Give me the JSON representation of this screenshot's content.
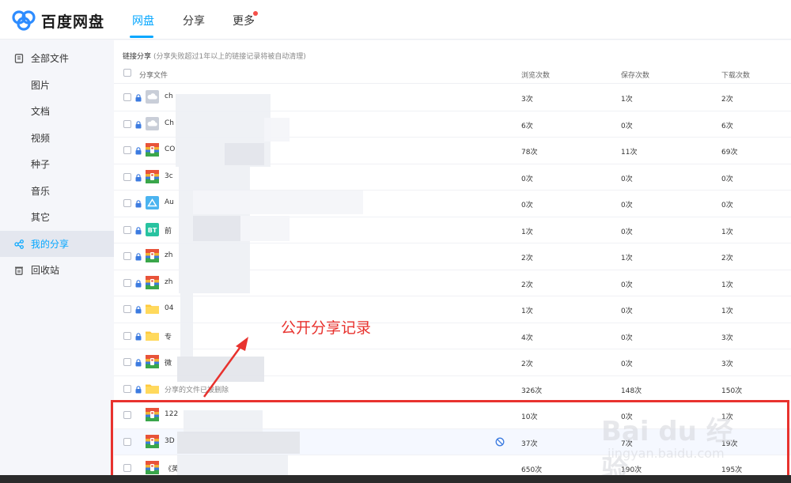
{
  "app": {
    "title": "百度网盘"
  },
  "nav": {
    "tabs": [
      "网盘",
      "分享",
      "更多"
    ],
    "active": 0
  },
  "sidebar": {
    "items": [
      "全部文件",
      "图片",
      "文档",
      "视频",
      "种子",
      "音乐",
      "其它",
      "我的分享",
      "回收站"
    ],
    "active": 7
  },
  "main": {
    "title": "链接分享",
    "hint": "(分享失败超过1年以上的链接记录将被自动清理)",
    "headers": {
      "file": "分享文件",
      "views": "浏览次数",
      "saves": "保存次数",
      "downloads": "下载次数"
    }
  },
  "rows": [
    {
      "name": "ch",
      "icon": "cloud",
      "views": "3次",
      "saves": "1次",
      "downloads": "2次"
    },
    {
      "name": "Ch",
      "icon": "cloud",
      "views": "6次",
      "saves": "0次",
      "downloads": "6次"
    },
    {
      "name": "CO",
      "icon": "archive",
      "views": "78次",
      "saves": "11次",
      "downloads": "69次"
    },
    {
      "name": "3c",
      "icon": "archive",
      "views": "0次",
      "saves": "0次",
      "downloads": "0次"
    },
    {
      "name": "Au",
      "icon": "app",
      "views": "0次",
      "saves": "0次",
      "downloads": "0次"
    },
    {
      "name": "前",
      "icon": "bt",
      "views": "1次",
      "saves": "0次",
      "downloads": "1次"
    },
    {
      "name": "zh",
      "icon": "archive",
      "views": "2次",
      "saves": "1次",
      "downloads": "2次"
    },
    {
      "name": "zh",
      "icon": "archive",
      "views": "2次",
      "saves": "0次",
      "downloads": "1次"
    },
    {
      "name": "04",
      "icon": "folder",
      "views": "1次",
      "saves": "0次",
      "downloads": "1次"
    },
    {
      "name": "专",
      "icon": "folder",
      "views": "4次",
      "saves": "0次",
      "downloads": "3次"
    },
    {
      "name": "微",
      "icon": "archive",
      "views": "2次",
      "saves": "0次",
      "downloads": "3次"
    },
    {
      "name": "分享的文件已被删除",
      "icon": "folder",
      "views": "326次",
      "saves": "148次",
      "downloads": "150次",
      "deleted": true
    },
    {
      "name": "122",
      "icon": "archive",
      "views": "10次",
      "saves": "0次",
      "downloads": "1次"
    },
    {
      "name": "3D",
      "icon": "archive",
      "views": "37次",
      "saves": "7次",
      "downloads": "19次",
      "banned": true
    },
    {
      "name": "《英",
      "icon": "archive",
      "views": "650次",
      "saves": "190次",
      "downloads": "195次"
    }
  ],
  "annotation": {
    "text": "公开分享记录"
  },
  "watermark": {
    "text": "Bai du 经验",
    "sub": "jingyan.baidu.com"
  },
  "colors": {
    "accent": "#06a7ff",
    "annotation": "#e8322e"
  }
}
